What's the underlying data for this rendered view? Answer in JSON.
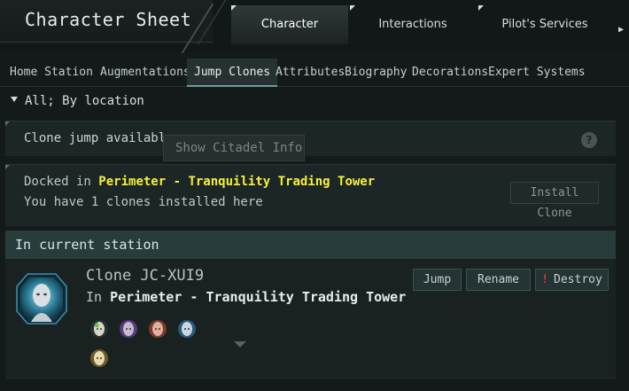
{
  "window": {
    "title": "Character Sheet"
  },
  "top_tabs": [
    {
      "label": "Character",
      "active": true
    },
    {
      "label": "Interactions",
      "active": false
    },
    {
      "label": "Pilot's Services",
      "active": false
    }
  ],
  "sub_tabs": [
    {
      "label": "Home Station"
    },
    {
      "label": "Augmentations"
    },
    {
      "label": "Jump Clones",
      "active": true
    },
    {
      "label": "Attributes"
    },
    {
      "label": "Biography"
    },
    {
      "label": "Decorations"
    },
    {
      "label": "Expert Systems"
    }
  ],
  "filter": {
    "label": "All; By location"
  },
  "clone_jump": {
    "label": "Clone jump available",
    "tooltip": "Show Citadel Info",
    "help_icon": "?"
  },
  "docked": {
    "prefix": "Docked in",
    "location": "Perimeter - Tranquility Trading Tower",
    "installed_text": "You have 1 clones installed here",
    "install_button": "Install Clone"
  },
  "section": {
    "title": "In current station"
  },
  "clone": {
    "name": "Clone JC-XUI9",
    "in_prefix": "In",
    "location": "Perimeter - Tranquility Trading Tower",
    "buttons": {
      "jump": "Jump",
      "rename": "Rename",
      "destroy": "Destroy",
      "destroy_mark": "!"
    },
    "implants": [
      "green-implant-icon",
      "purple-implant-icon",
      "red-implant-icon",
      "blue-implant-icon",
      "gold-implant-icon"
    ]
  },
  "colors": {
    "accent_yellow": "#f5f03a",
    "destroy_red": "#e0342c",
    "section_bg": "#283c3c"
  }
}
